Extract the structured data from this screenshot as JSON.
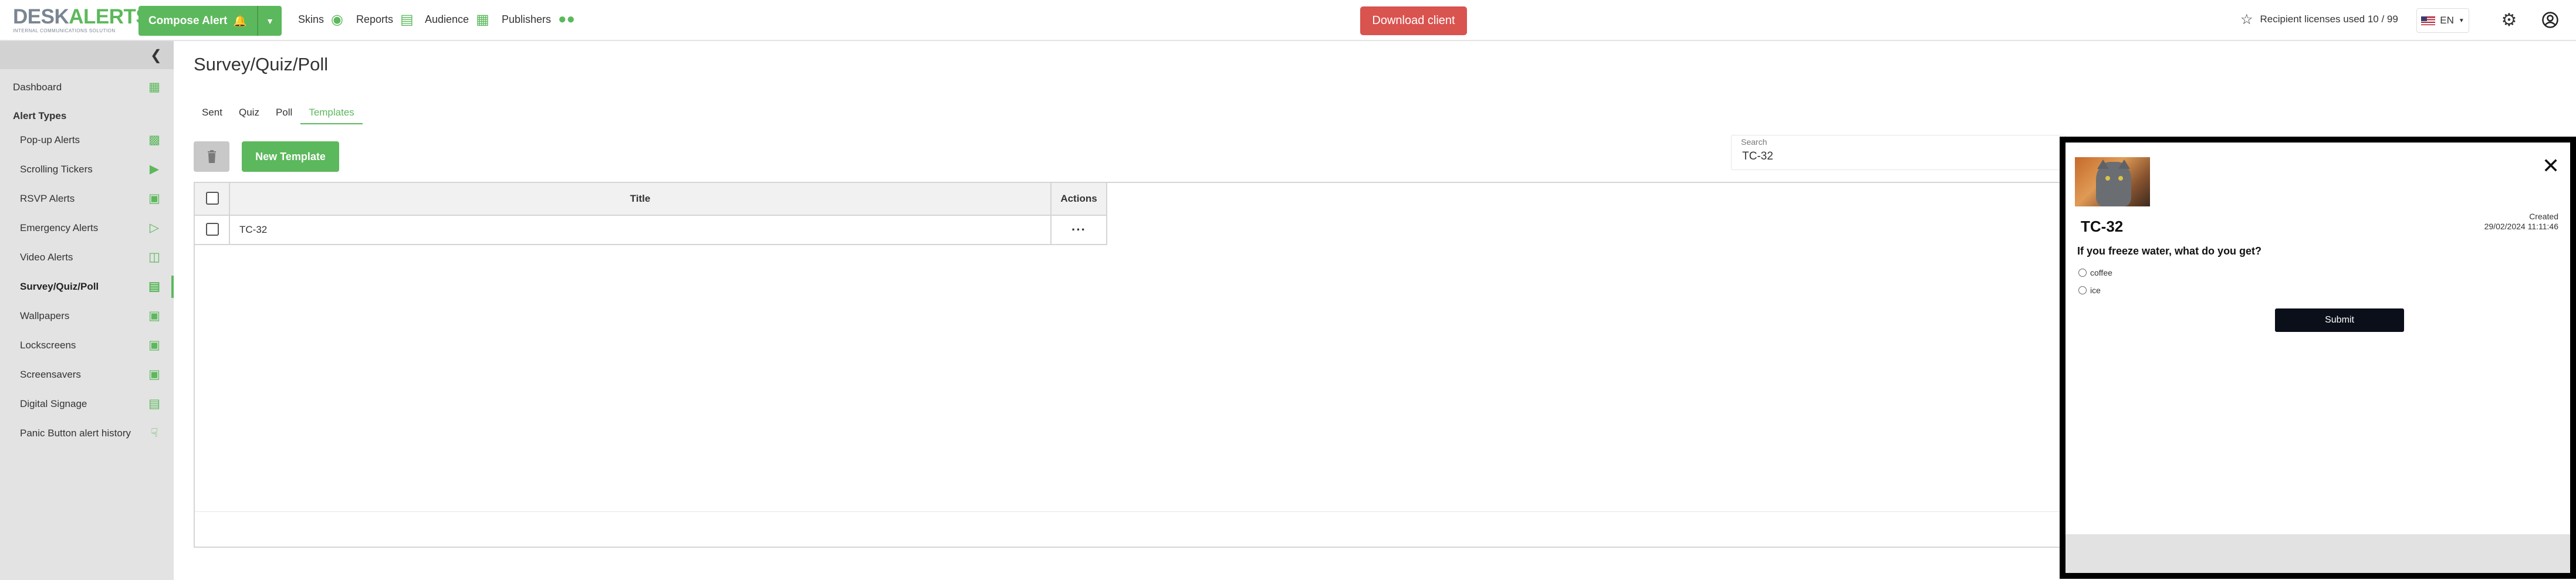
{
  "header": {
    "logo_word1": "DESK",
    "logo_word2": "ALERTS",
    "logo_tagline": "INTERNAL COMMUNICATIONS SOLUTION",
    "compose_label": "Compose Alert",
    "nav": [
      {
        "label": "Skins",
        "icon": "palette-icon"
      },
      {
        "label": "Reports",
        "icon": "chart-icon"
      },
      {
        "label": "Audience",
        "icon": "building-icon"
      },
      {
        "label": "Publishers",
        "icon": "people-icon"
      }
    ],
    "download_label": "Download client",
    "licenses_text": "Recipient licenses used 10 / 99",
    "language": "EN",
    "colors": {
      "accent": "#5cb85c",
      "danger": "#d9534f"
    }
  },
  "sidebar": {
    "dashboard": "Dashboard",
    "section_label": "Alert Types",
    "items": [
      {
        "label": "Pop-up Alerts",
        "icon": "popup-alert-icon"
      },
      {
        "label": "Scrolling Tickers",
        "icon": "ticker-icon"
      },
      {
        "label": "RSVP Alerts",
        "icon": "chat-bubbles-icon"
      },
      {
        "label": "Emergency Alerts",
        "icon": "megaphone-icon"
      },
      {
        "label": "Video Alerts",
        "icon": "video-camera-icon"
      },
      {
        "label": "Survey/Quiz/Poll",
        "icon": "survey-icon"
      },
      {
        "label": "Wallpapers",
        "icon": "wallpaper-icon"
      },
      {
        "label": "Lockscreens",
        "icon": "lockscreen-icon"
      },
      {
        "label": "Screensavers",
        "icon": "screensaver-icon"
      },
      {
        "label": "Digital Signage",
        "icon": "signage-icon"
      },
      {
        "label": "Panic Button alert history",
        "icon": "touch-icon"
      }
    ],
    "active": "Survey/Quiz/Poll"
  },
  "main": {
    "title": "Survey/Quiz/Poll",
    "tabs": [
      "Sent",
      "Quiz",
      "Poll",
      "Templates"
    ],
    "active_tab": "Templates",
    "new_template_label": "New Template",
    "search": {
      "label": "Search",
      "value": "TC-32"
    },
    "table": {
      "columns": [
        "Title",
        "Actions"
      ],
      "rows": [
        {
          "title": "TC-32",
          "actions": "···"
        }
      ]
    }
  },
  "preview": {
    "title": "TC-32",
    "created_label": "Created",
    "created_date": "29/02/2024 11:11:46",
    "question": "If you freeze water, what do you get?",
    "options": [
      "coffee",
      "ice"
    ],
    "submit_label": "Submit",
    "close_glyph": "✕"
  }
}
